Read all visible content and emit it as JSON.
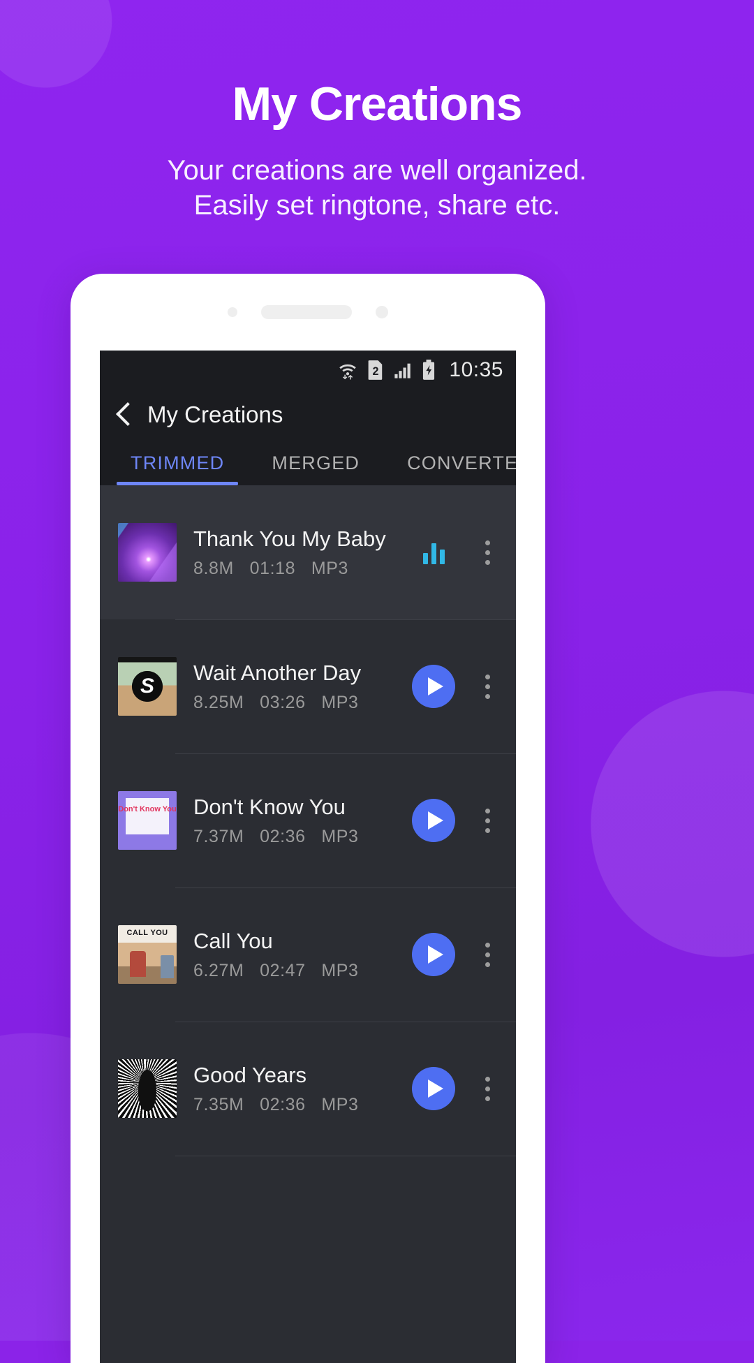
{
  "promo": {
    "title": "My Creations",
    "subtitle_line1": "Your creations are well organized.",
    "subtitle_line2": "Easily set ringtone, share etc.",
    "background_color": "#8b23e8",
    "text_color": "#ffffff"
  },
  "statusbar": {
    "wifi_icon": "wifi-data-transfer-icon",
    "sim_icon": "sim-card-2-icon",
    "sim_label": "2",
    "signal_icon": "cellular-signal-icon",
    "battery_icon": "battery-charging-icon",
    "time": "10:35"
  },
  "appbar": {
    "back_icon": "back-chevron-icon",
    "title": "My Creations"
  },
  "tabs": {
    "active_index": 0,
    "accent_color": "#6e86f7",
    "items": [
      {
        "label": "TRIMMED"
      },
      {
        "label": "MERGED"
      },
      {
        "label": "CONVERTED A"
      }
    ]
  },
  "list": {
    "play_button_color": "#4e6ef2",
    "equalizer_color": "#31b8e6",
    "items": [
      {
        "title": "Thank You My Baby",
        "size": "8.8M",
        "duration": "01:18",
        "format": "MP3",
        "state": "playing",
        "action_icon": "equalizer-icon",
        "menu_icon": "more-vertical-icon",
        "artwork": "art1"
      },
      {
        "title": "Wait Another Day",
        "size": "8.25M",
        "duration": "03:26",
        "format": "MP3",
        "state": "paused",
        "action_icon": "play-icon",
        "menu_icon": "more-vertical-icon",
        "artwork": "art2"
      },
      {
        "title": "Don't Know You",
        "size": "7.37M",
        "duration": "02:36",
        "format": "MP3",
        "state": "paused",
        "action_icon": "play-icon",
        "menu_icon": "more-vertical-icon",
        "artwork": "art3"
      },
      {
        "title": "Call You",
        "size": "6.27M",
        "duration": "02:47",
        "format": "MP3",
        "state": "paused",
        "action_icon": "play-icon",
        "menu_icon": "more-vertical-icon",
        "artwork": "art4"
      },
      {
        "title": "Good Years",
        "size": "7.35M",
        "duration": "02:36",
        "format": "MP3",
        "state": "paused",
        "action_icon": "play-icon",
        "menu_icon": "more-vertical-icon",
        "artwork": "art5"
      }
    ]
  },
  "artwork_text": {
    "art2_logo": "S",
    "art3_title": "Don't Know You",
    "art4_title": "CALL YOU"
  }
}
